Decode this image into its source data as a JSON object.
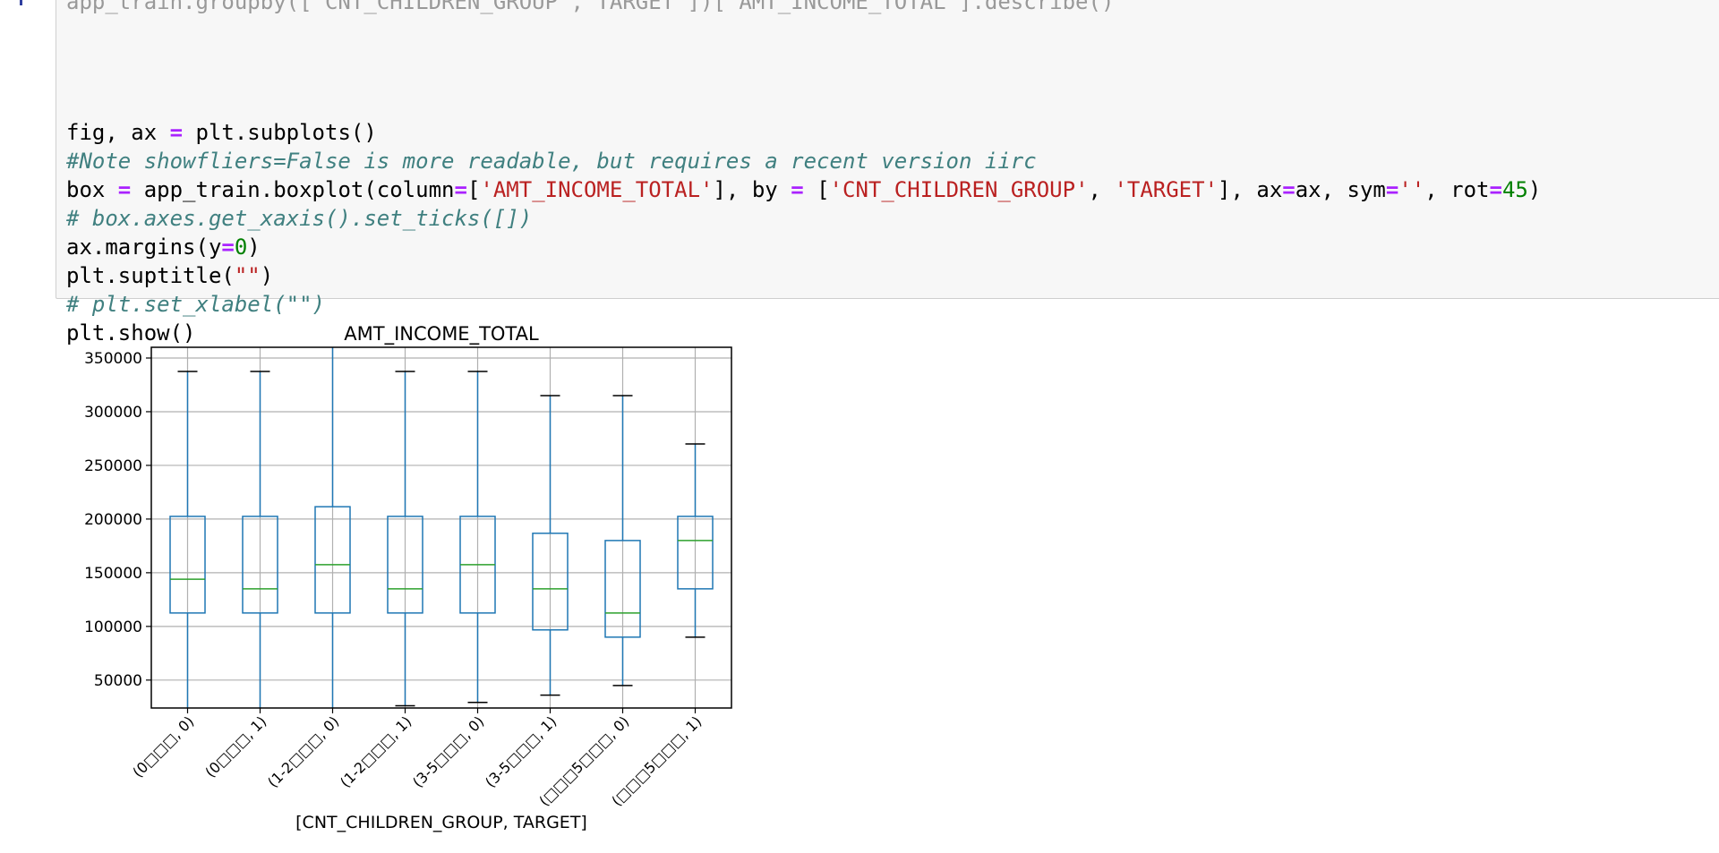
{
  "code_cell": {
    "partial_line_top": "app_train.groupby(['CNT_CHILDREN_GROUP','TARGET'])['AMT_INCOME_TOTAL'].describe()",
    "lines": [
      [
        {
          "t": "plain",
          "v": "fig, ax "
        },
        {
          "t": "op",
          "v": "="
        },
        {
          "t": "plain",
          "v": " plt.subplots()"
        }
      ],
      [
        {
          "t": "com",
          "v": "#Note showfliers=False is more readable, but requires a recent version iirc"
        }
      ],
      [
        {
          "t": "plain",
          "v": "box "
        },
        {
          "t": "op",
          "v": "="
        },
        {
          "t": "plain",
          "v": " app_train.boxplot(column"
        },
        {
          "t": "op",
          "v": "="
        },
        {
          "t": "plain",
          "v": "["
        },
        {
          "t": "str",
          "v": "'AMT_INCOME_TOTAL'"
        },
        {
          "t": "plain",
          "v": "], by "
        },
        {
          "t": "op",
          "v": "="
        },
        {
          "t": "plain",
          "v": " ["
        },
        {
          "t": "str",
          "v": "'CNT_CHILDREN_GROUP'"
        },
        {
          "t": "plain",
          "v": ", "
        },
        {
          "t": "str",
          "v": "'TARGET'"
        },
        {
          "t": "plain",
          "v": "], ax"
        },
        {
          "t": "op",
          "v": "="
        },
        {
          "t": "plain",
          "v": "ax, sym"
        },
        {
          "t": "op",
          "v": "="
        },
        {
          "t": "str",
          "v": "''"
        },
        {
          "t": "plain",
          "v": ", rot"
        },
        {
          "t": "op",
          "v": "="
        },
        {
          "t": "num",
          "v": "45"
        },
        {
          "t": "plain",
          "v": ")"
        }
      ],
      [
        {
          "t": "com",
          "v": "# box.axes.get_xaxis().set_ticks([])"
        }
      ],
      [
        {
          "t": "plain",
          "v": "ax.margins(y"
        },
        {
          "t": "op",
          "v": "="
        },
        {
          "t": "num",
          "v": "0"
        },
        {
          "t": "plain",
          "v": ")"
        }
      ],
      [
        {
          "t": "plain",
          "v": "plt.suptitle("
        },
        {
          "t": "str",
          "v": "\"\""
        },
        {
          "t": "plain",
          "v": ")"
        }
      ],
      [
        {
          "t": "com",
          "v": "# plt.set_xlabel(\"\")"
        }
      ],
      [
        {
          "t": "plain",
          "v": "plt.show()"
        }
      ]
    ]
  },
  "chart_data": {
    "type": "box",
    "title": "AMT_INCOME_TOTAL",
    "xlabel": "[CNT_CHILDREN_GROUP, TARGET]",
    "ylabel": "",
    "ylim": [
      24000,
      360000
    ],
    "yticks": [
      50000,
      100000,
      150000,
      200000,
      250000,
      300000,
      350000
    ],
    "grid": true,
    "categories": [
      "(0□□□, 0)",
      "(0□□□, 1)",
      "(1-2□□□, 0)",
      "(1-2□□□, 1)",
      "(3-5□□□, 0)",
      "(3-5□□□, 1)",
      "(□□□5□□□, 0)",
      "(□□□5□□□, 1)"
    ],
    "boxes": [
      {
        "whislo": 24000,
        "q1": 112500,
        "median": 144000,
        "q3": 202500,
        "whishi": 337500
      },
      {
        "whislo": 24000,
        "q1": 112500,
        "median": 135000,
        "q3": 202500,
        "whishi": 337500
      },
      {
        "whislo": 24000,
        "q1": 112500,
        "median": 157500,
        "q3": 211500,
        "whishi": 360000
      },
      {
        "whislo": 26100,
        "q1": 112500,
        "median": 135000,
        "q3": 202500,
        "whishi": 337500
      },
      {
        "whislo": 29250,
        "q1": 112500,
        "median": 157500,
        "q3": 202500,
        "whishi": 337500
      },
      {
        "whislo": 36000,
        "q1": 96750,
        "median": 135000,
        "q3": 186750,
        "whishi": 315000
      },
      {
        "whislo": 45000,
        "q1": 90000,
        "median": 112500,
        "q3": 180000,
        "whishi": 315000
      },
      {
        "whislo": 90000,
        "q1": 135000,
        "median": 180000,
        "q3": 202500,
        "whishi": 270000
      }
    ],
    "colors": {
      "box": "#1f77b4",
      "median": "#2ca02c",
      "cap": "#000000",
      "grid": "#b0b0b0",
      "frame": "#000000"
    }
  }
}
